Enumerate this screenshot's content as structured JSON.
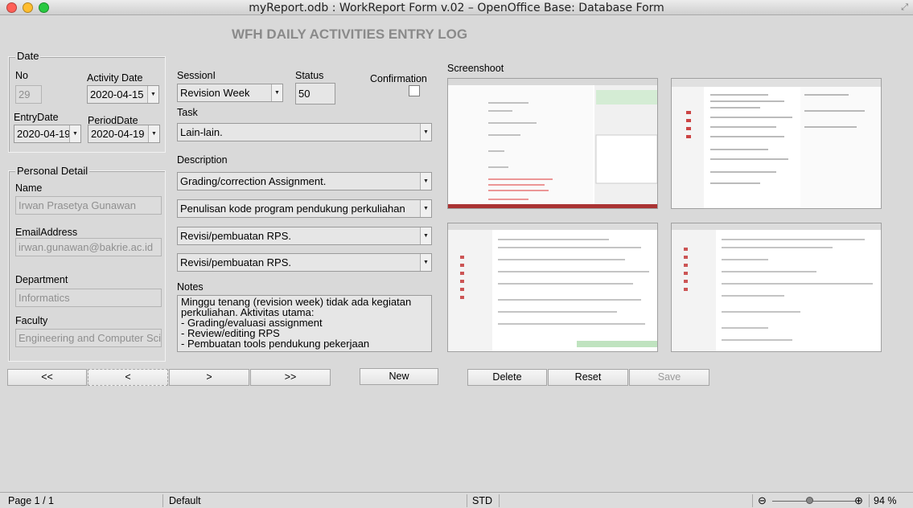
{
  "window": {
    "title": "myReport.odb : WorkReport Form v.02 – OpenOffice Base: Database Form",
    "colors": {
      "close": "#ff5f57",
      "minimize": "#ffbd2e",
      "zoom": "#28c940"
    }
  },
  "form": {
    "title": "WFH DAILY ACTIVITIES ENTRY LOG",
    "date_group": {
      "label": "Date",
      "no_label": "No",
      "no_value": "29",
      "activity_date_label": "Activity Date",
      "activity_date_value": "2020-04-15",
      "entry_date_label": "EntryDate",
      "entry_date_value": "2020-04-19",
      "period_date_label": "PeriodDate",
      "period_date_value": "2020-04-19"
    },
    "personal_group": {
      "label": "Personal Detail",
      "name_label": "Name",
      "name_value": "Irwan Prasetya Gunawan",
      "email_label": "EmailAddress",
      "email_value": "irwan.gunawan@bakrie.ac.id",
      "department_label": "Department",
      "department_value": "Informatics",
      "faculty_label": "Faculty",
      "faculty_value": "Engineering and Computer Science"
    },
    "session_label": "SessionI",
    "session_value": "Revision Week",
    "status_label": "Status",
    "status_value": "50",
    "confirmation_label": "Confirmation",
    "task_label": "Task",
    "task_value": "Lain-lain.",
    "description_label": "Description",
    "descriptions": [
      "Grading/correction Assignment.",
      "Penulisan kode program pendukung perkuliahan",
      "Revisi/pembuatan RPS.",
      "Revisi/pembuatan RPS."
    ],
    "notes_label": "Notes",
    "notes_value": "Minggu tenang (revision week) tidak ada kegiatan perkuliahan. Aktivitas utama:\n- Grading/evaluasi assignment\n- Review/editing RPS\n- Pembuatan tools pendukung pekerjaan",
    "screenshoot_label": "Screenshoot"
  },
  "nav": {
    "first": "<<",
    "prev": "<",
    "next": ">",
    "last": ">>"
  },
  "actions": {
    "new": "New",
    "delete": "Delete",
    "reset": "Reset",
    "save": "Save"
  },
  "statusbar": {
    "page": "Page 1 / 1",
    "style": "Default",
    "mode": "STD",
    "zoom": "94 %",
    "zoom_level": 0.45
  }
}
